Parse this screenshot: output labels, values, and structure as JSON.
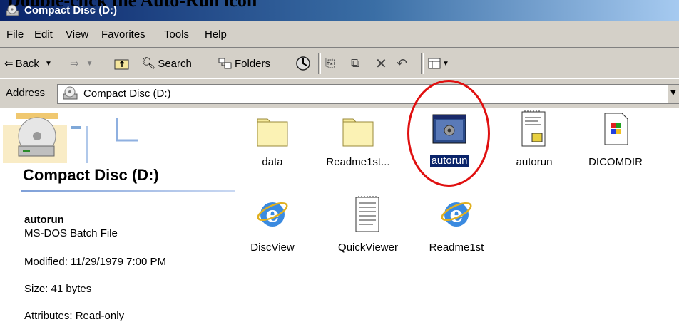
{
  "caption": "Double-click the Auto-Run icon",
  "window": {
    "title": "Compact Disc (D:)"
  },
  "menu": [
    "File",
    "Edit",
    "View",
    "Favorites",
    "Tools",
    "Help"
  ],
  "toolbar": {
    "back_label": "Back",
    "search_label": "Search",
    "folders_label": "Folders"
  },
  "address": {
    "label": "Address",
    "value": "Compact Disc (D:)"
  },
  "left_panel": {
    "title": "Compact Disc (D:)",
    "selected_name": "autorun",
    "selected_type": "MS-DOS Batch File",
    "modified": "Modified: 11/29/1979 7:00 PM",
    "size": "Size: 41 bytes",
    "attributes": "Attributes: Read-only"
  },
  "files": [
    {
      "name": "data",
      "icon": "folder-icon"
    },
    {
      "name": "Readme1st...",
      "icon": "folder-icon"
    },
    {
      "name": "autorun",
      "icon": "batch-file-icon",
      "selected": true
    },
    {
      "name": "autorun",
      "icon": "setup-info-icon"
    },
    {
      "name": "DICOMDIR",
      "icon": "windows-file-icon"
    },
    {
      "name": "DiscView",
      "icon": "internet-explorer-icon"
    },
    {
      "name": "QuickViewer",
      "icon": "text-file-icon"
    },
    {
      "name": "Readme1st",
      "icon": "internet-explorer-icon"
    }
  ],
  "colors": {
    "selection": "#0a246a",
    "highlight_circle": "#e01010",
    "titlebar": "#0a246a"
  }
}
